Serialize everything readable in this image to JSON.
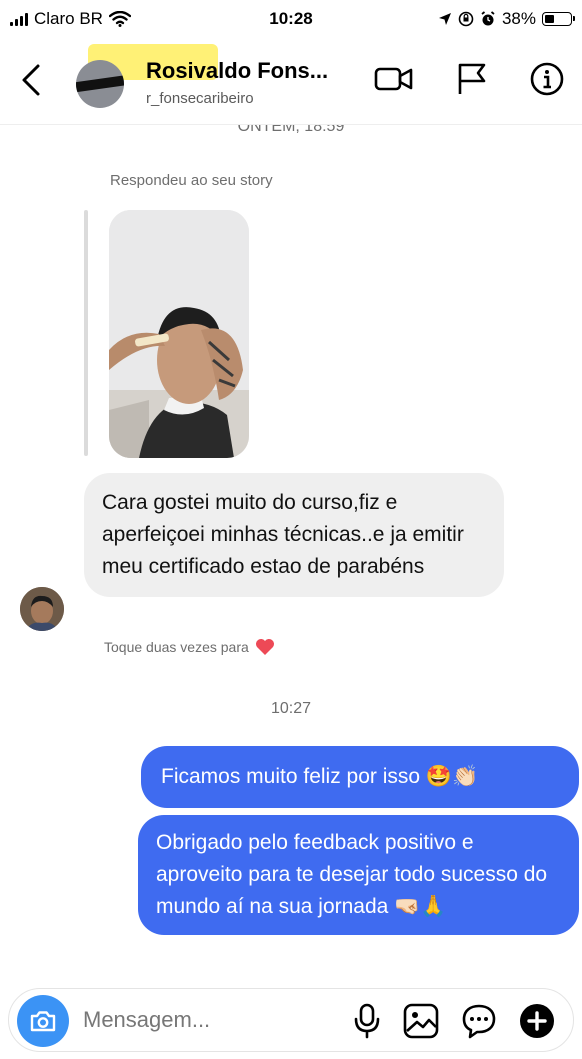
{
  "status_bar": {
    "carrier": "Claro BR",
    "time": "10:28",
    "battery": "38%",
    "battery_level": 0.38
  },
  "header": {
    "name": "Rosivaldo Fons...",
    "username": "r_fonsecaribeiro",
    "icons": [
      "back-icon",
      "video-camera-icon",
      "flag-icon",
      "info-icon"
    ]
  },
  "chat": {
    "day_stamp": "ONTEM, 18:59",
    "story_reply_label": "Respondeu ao seu story",
    "incoming_message": "Cara gostei muito do curso,fiz e aperfeiçoei minhas técnicas..e ja emitir meu certificado estao de parabéns",
    "like_hint": "Toque duas vezes para",
    "time_stamp": "10:27",
    "outgoing_messages": [
      "Ficamos muito feliz por isso 🤩👏🏻",
      "Obrigado pelo feedback positivo e aproveito para te desejar todo sucesso do mundo aí na sua jornada 🤜🏻🙏"
    ]
  },
  "composer": {
    "placeholder": "Mensagem...",
    "icons": [
      "camera-icon",
      "microphone-icon",
      "gallery-icon",
      "sticker-icon",
      "add-icon"
    ]
  },
  "colors": {
    "outgoing_bubble": "#3f6bf0",
    "incoming_bubble": "#efefef",
    "camera_button": "#3b93f5"
  }
}
